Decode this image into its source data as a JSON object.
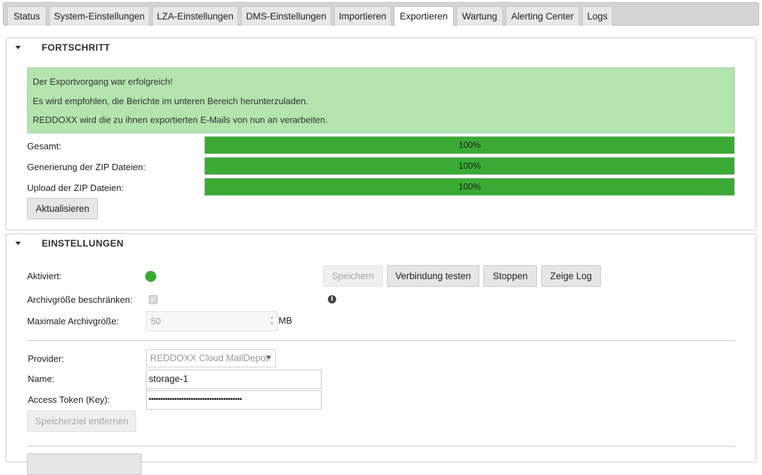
{
  "tabs": [
    {
      "label": "Status"
    },
    {
      "label": "System-Einstellungen"
    },
    {
      "label": "LZA-Einstellungen"
    },
    {
      "label": "DMS-Einstellungen"
    },
    {
      "label": "Importieren"
    },
    {
      "label": "Exportieren",
      "active": true
    },
    {
      "label": "Wartung"
    },
    {
      "label": "Alerting Center"
    },
    {
      "label": "Logs"
    }
  ],
  "progress_panel": {
    "title": "FORTSCHRITT",
    "messages": [
      "Der Exportvorgang war erfolgreich!",
      "Es wird empfohlen, die Berichte im unteren Bereich herunterzuladen.",
      "REDDOXX wird die zu ihnen exportierten E-Mails von nun an verarbeiten."
    ],
    "bars": [
      {
        "label": "Gesamt:",
        "percent": 100,
        "text": "100%"
      },
      {
        "label": "Generierung der ZIP Dateien:",
        "percent": 100,
        "text": "100%"
      },
      {
        "label": "Upload der ZIP Dateien:",
        "percent": 100,
        "text": "100%"
      }
    ],
    "refresh_label": "Aktualisieren"
  },
  "settings_panel": {
    "title": "EINSTELLUNGEN",
    "activated_label": "Aktiviert:",
    "activated": true,
    "limit_label": "Archivgröße beschränken:",
    "limit_checked": true,
    "max_size_label": "Maximale Archivgröße:",
    "max_size_value": "50",
    "max_size_unit": "MB",
    "save_label": "Speichern",
    "test_label": "Verbindung testen",
    "stop_label": "Stoppen",
    "log_label": "Zeige Log",
    "provider_label": "Provider:",
    "provider_value": "REDDOXX Cloud MailDepot",
    "name_label": "Name:",
    "name_value": "storage-1",
    "token_label": "Access Token (Key):",
    "token_value": "••••••••••••••••••••••••••••••••••••••••",
    "remove_label": "Speicherziel entfernen"
  },
  "colors": {
    "success_bg": "#b3e4ae",
    "progress_fill": "#3aaa35",
    "status_on": "#3aaa35"
  },
  "icons": {
    "collapse": "caret-down-icon",
    "status": "green-dot-icon",
    "info": "info-icon"
  }
}
